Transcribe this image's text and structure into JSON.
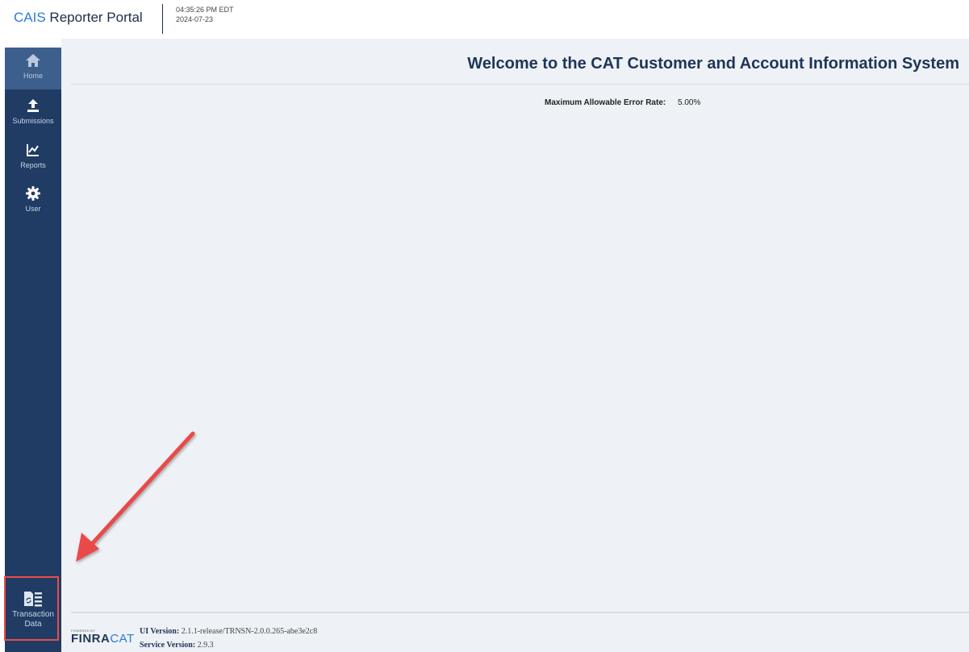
{
  "header": {
    "brand_prefix": "CAIS",
    "brand_suffix": "Reporter Portal",
    "time": "04:35:26 PM EDT",
    "date": "2024-07-23"
  },
  "sidebar": {
    "items": [
      {
        "label": "Home",
        "icon": "home-icon",
        "active": true
      },
      {
        "label": "Submissions",
        "icon": "upload-icon",
        "active": false
      },
      {
        "label": "Reports",
        "icon": "chart-icon",
        "active": false
      },
      {
        "label": "User",
        "icon": "gear-icon",
        "active": false
      }
    ],
    "transaction": {
      "line1": "Transaction",
      "line2": "Data",
      "icon": "transaction-data-icon"
    }
  },
  "main": {
    "title": "Welcome to the CAT Customer and Account Information System",
    "error_rate_label": "Maximum Allowable Error Rate:",
    "error_rate_value": "5.00%"
  },
  "footer": {
    "powered_by": "POWERED BY",
    "logo_finra": "FINRA",
    "logo_cat": "CAT",
    "ui_version_label": "UI Version:",
    "ui_version_value": "2.1.1-release/TRNSN-2.0.0.265-abe3e2c8",
    "service_version_label": "Service Version:",
    "service_version_value": "2.9.3"
  },
  "colors": {
    "sidebar": "#203c64",
    "sidebar_active": "#3d5f8d",
    "accent": "#2a7bd8",
    "annotation": "#e84c4a"
  }
}
